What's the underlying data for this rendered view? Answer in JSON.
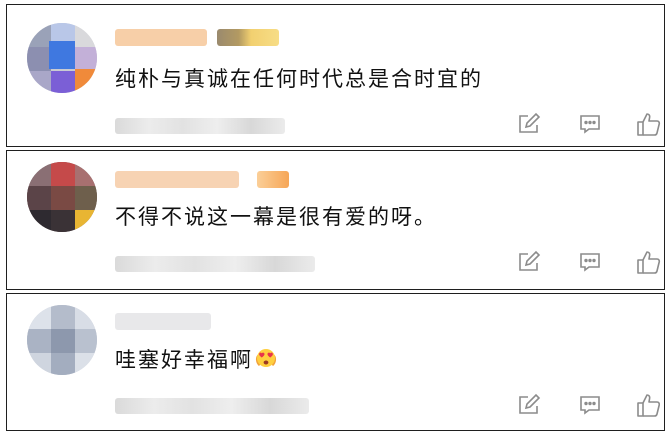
{
  "comments": [
    {
      "text": "纯朴与真诚在任何时代总是合时宜的",
      "emoji": ""
    },
    {
      "text": "不得不说这一幕是很有爱的呀。",
      "emoji": ""
    },
    {
      "text": "哇塞好幸福啊",
      "emoji": "heart-eyes-emoji"
    }
  ],
  "icons": {
    "edit": "edit-icon",
    "reply": "comment-icon",
    "like": "thumbs-up-icon"
  },
  "colors": {
    "icon": "#8c8c8c",
    "border": "#1f1f1f",
    "text": "#111111"
  }
}
